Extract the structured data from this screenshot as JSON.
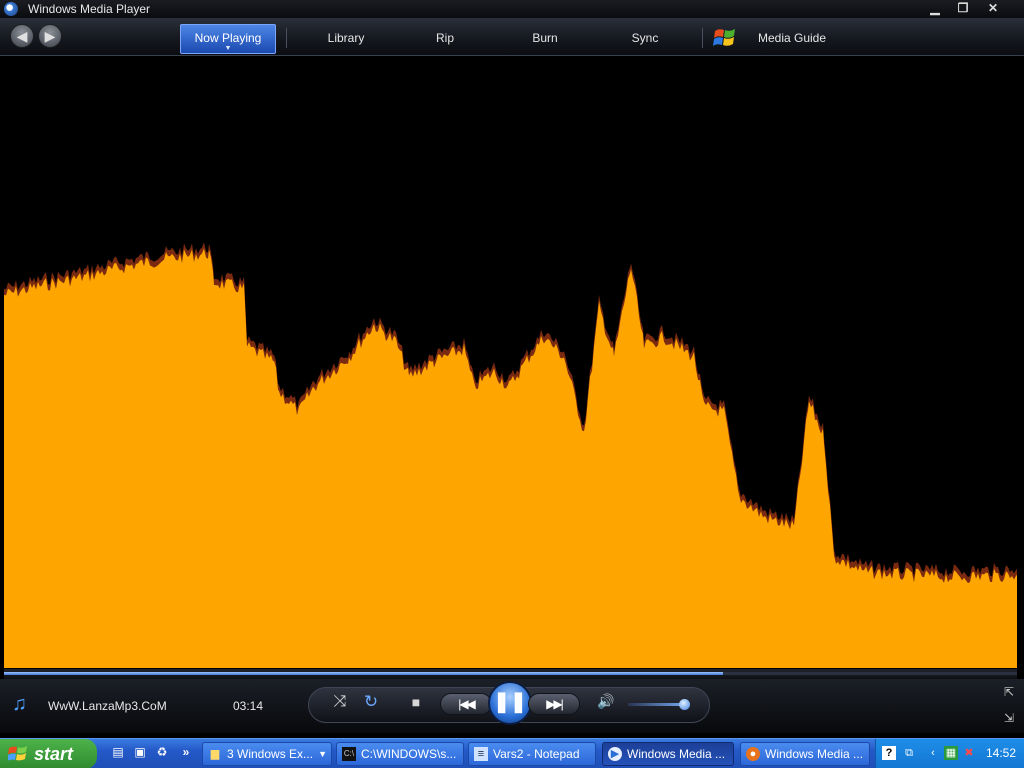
{
  "window": {
    "title": "Windows Media Player",
    "minimize": "▁",
    "restore": "❐",
    "close": "✕"
  },
  "nav": {
    "back": "◀",
    "forward": "▶",
    "tabs": [
      {
        "label": "Now Playing",
        "active": true
      },
      {
        "label": "Library",
        "active": false
      },
      {
        "label": "Rip",
        "active": false
      },
      {
        "label": "Burn",
        "active": false
      },
      {
        "label": "Sync",
        "active": false
      },
      {
        "label": "Media Guide",
        "active": false
      }
    ],
    "caret": "▼"
  },
  "visualization": {
    "color": "#FFA500",
    "background": "#000000"
  },
  "seek": {
    "progress": 0.71
  },
  "player": {
    "track_title": "WwW.LanzaMp3.CoM",
    "time": "03:14",
    "shuffle": "⤨",
    "repeat": "↻",
    "stop": "■",
    "previous": "|◀◀",
    "play_pause": "❚❚",
    "next": "▶▶|",
    "mute": "🔊",
    "volume": 0.9,
    "accent": "#2a6fd6"
  },
  "taskbar": {
    "start_label": "start",
    "quick_launch": [
      "show-desktop-icon",
      "explorer-icon",
      "recycle-icon"
    ],
    "chevron": "»",
    "tasks": [
      {
        "label": "3 Windows Ex...",
        "icon": "folder-icon",
        "active": false
      },
      {
        "label": "C:\\WINDOWS\\s...",
        "icon": "console-icon",
        "active": false
      },
      {
        "label": "Vars2 - Notepad",
        "icon": "notepad-icon",
        "active": false
      },
      {
        "label": "Windows Media ...",
        "icon": "media-player-icon",
        "active": true
      },
      {
        "label": "Windows Media ...",
        "icon": "firefox-icon",
        "active": false
      }
    ],
    "clock": "14:52"
  }
}
